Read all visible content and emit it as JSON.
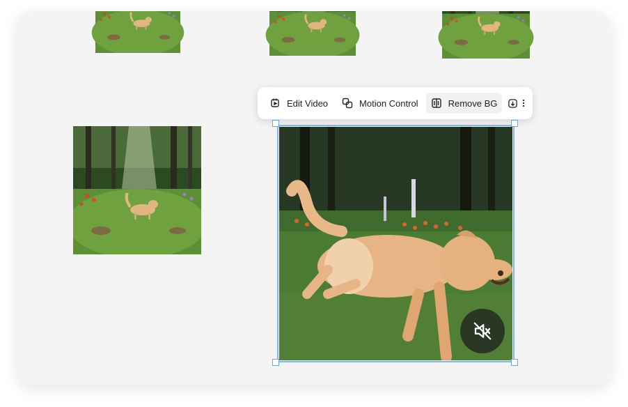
{
  "toolbar": {
    "edit_video_label": "Edit Video",
    "motion_control_label": "Motion Control",
    "remove_bg_label": "Remove BG",
    "download_icon": "download-icon",
    "more_icon": "more-vertical-icon"
  },
  "gallery": {
    "thumbnails": [
      {
        "name": "thumbnail-1",
        "icon": "forest-dog-image"
      },
      {
        "name": "thumbnail-2",
        "icon": "forest-dog-image"
      },
      {
        "name": "thumbnail-3",
        "icon": "forest-dog-image"
      },
      {
        "name": "thumbnail-4",
        "icon": "forest-dog-image"
      }
    ],
    "selected": {
      "name": "selected-video-frame",
      "icon": "running-dog-image"
    }
  },
  "player": {
    "mute_icon": "volume-muted-icon",
    "muted": true
  },
  "colors": {
    "selection_border": "#7fb6e6",
    "canvas_bg": "#f4f4f4",
    "toolbar_active_bg": "#f1f1f1"
  }
}
